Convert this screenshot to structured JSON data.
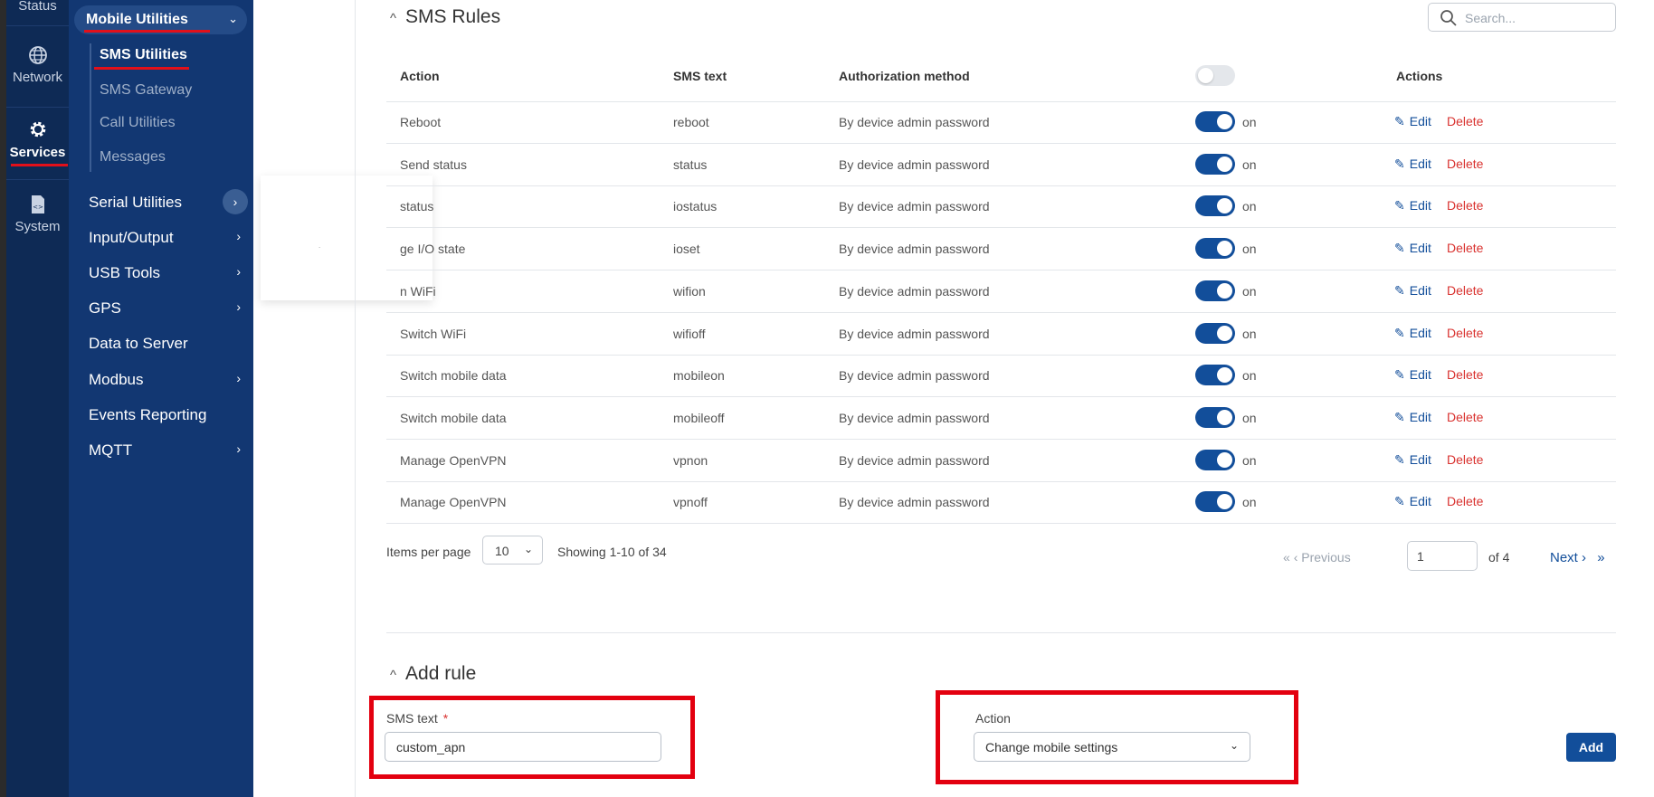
{
  "rail": {
    "status": "Status",
    "network": "Network",
    "services": "Services",
    "system": "System"
  },
  "menu": {
    "group": "Mobile Utilities",
    "sub_items": [
      "SMS Utilities",
      "SMS Gateway",
      "Call Utilities",
      "Messages"
    ],
    "items": [
      "Serial Utilities",
      "Input/Output",
      "USB Tools",
      "GPS",
      "Data to Server",
      "Modbus",
      "Events Reporting",
      "MQTT"
    ]
  },
  "popover": {
    "dot": "."
  },
  "sms_rules": {
    "title": "SMS Rules",
    "search_placeholder": "Search...",
    "columns": {
      "action": "Action",
      "sms_text": "SMS text",
      "auth": "Authorization method",
      "actions": "Actions"
    },
    "rows": [
      {
        "action": "Reboot",
        "sms_text": "reboot",
        "auth": "By device admin password",
        "state": "on"
      },
      {
        "action": "Send status",
        "sms_text": "status",
        "auth": "By device admin password",
        "state": "on"
      },
      {
        "action": "status",
        "sms_text": "iostatus",
        "auth": "By device admin password",
        "state": "on"
      },
      {
        "action": "ge I/O state",
        "sms_text": "ioset",
        "auth": "By device admin password",
        "state": "on"
      },
      {
        "action": "n WiFi",
        "sms_text": "wifion",
        "auth": "By device admin password",
        "state": "on"
      },
      {
        "action": "Switch WiFi",
        "sms_text": "wifioff",
        "auth": "By device admin password",
        "state": "on"
      },
      {
        "action": "Switch mobile data",
        "sms_text": "mobileon",
        "auth": "By device admin password",
        "state": "on"
      },
      {
        "action": "Switch mobile data",
        "sms_text": "mobileoff",
        "auth": "By device admin password",
        "state": "on"
      },
      {
        "action": "Manage OpenVPN",
        "sms_text": "vpnon",
        "auth": "By device admin password",
        "state": "on"
      },
      {
        "action": "Manage OpenVPN",
        "sms_text": "vpnoff",
        "auth": "By device admin password",
        "state": "on"
      }
    ],
    "edit_label": "Edit",
    "delete_label": "Delete"
  },
  "pagination": {
    "items_per_page_label": "Items per page",
    "items_per_page": "10",
    "showing": "Showing 1-10 of 34",
    "previous": "Previous",
    "page": "1",
    "of": "of 4",
    "next": "Next"
  },
  "add_rule": {
    "title": "Add rule",
    "sms_text_label": "SMS text",
    "required_mark": "*",
    "sms_text_value": "custom_apn",
    "action_label": "Action",
    "action_value": "Change mobile settings",
    "add_label": "Add"
  },
  "colors": {
    "accent": "#124e9a",
    "danger": "#d9322f",
    "highlight": "#e3000f",
    "nav": "#123772"
  }
}
